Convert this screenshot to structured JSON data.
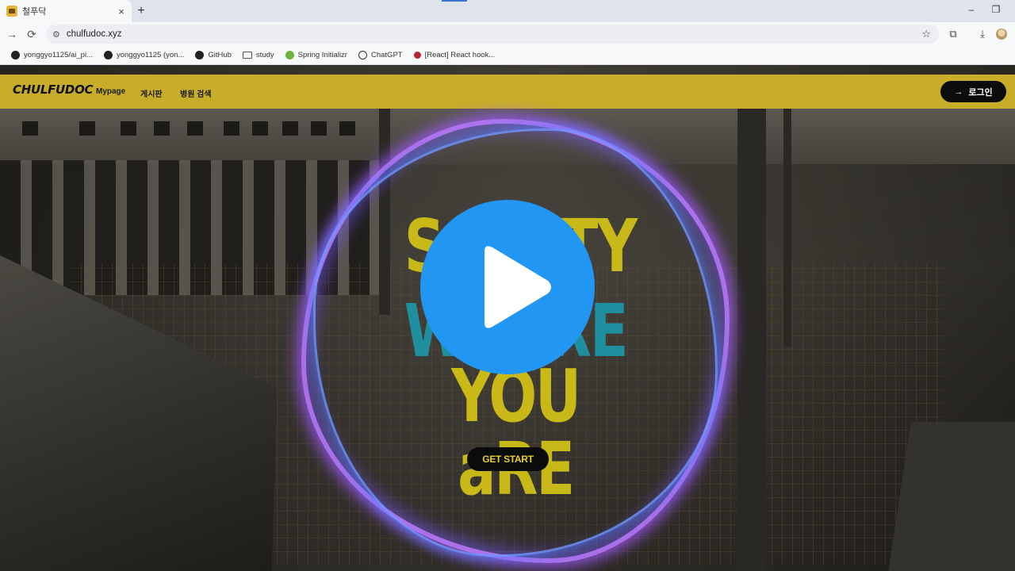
{
  "browser": {
    "tab_title": "철푸닥",
    "tab_close": "×",
    "new_tab": "+",
    "url": "chulfudoc.xyz",
    "window_controls": {
      "minimize": "–",
      "restore": "❐"
    },
    "bookmarks": [
      {
        "label": "yonggyo1125/ai_pi...",
        "icon": "github-icon"
      },
      {
        "label": "yonggyo1125 (yon...",
        "icon": "github-icon"
      },
      {
        "label": "GitHub",
        "icon": "github-icon"
      },
      {
        "label": "study",
        "icon": "folder-icon"
      },
      {
        "label": "Spring Initializr",
        "icon": "spring-icon"
      },
      {
        "label": "ChatGPT",
        "icon": "chatgpt-icon"
      },
      {
        "label": "[React] React hook...",
        "icon": "react-icon"
      }
    ]
  },
  "site": {
    "logo": "CHULFUDOC",
    "nav": [
      "Mypage",
      "게시판",
      "병원 검색"
    ],
    "login_label": "로그인",
    "login_icon": "→",
    "brand_color": "#c7ad2a"
  },
  "hero": {
    "line1": "SAFETY",
    "line2": "WHERE",
    "line3": "YOU aRE",
    "cta": "GET START",
    "accent_yellow": "#c9b918",
    "accent_teal": "#1f8fa0"
  },
  "video_overlay": {
    "icon": "play-icon",
    "color": "#2196f3"
  }
}
